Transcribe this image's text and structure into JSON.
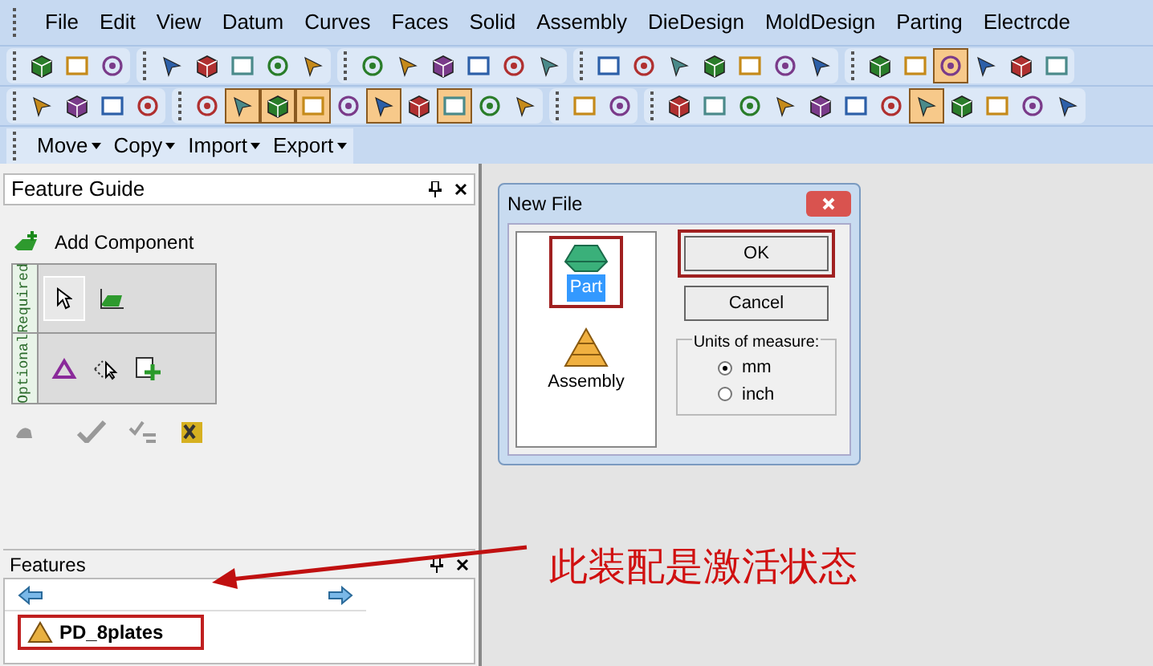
{
  "menu": [
    "File",
    "Edit",
    "View",
    "Datum",
    "Curves",
    "Faces",
    "Solid",
    "Assembly",
    "DieDesign",
    "MoldDesign",
    "Parting",
    "Electrcde"
  ],
  "toolbars": [
    [
      [
        {
          "pressed": false
        },
        {
          "pressed": false
        },
        {
          "pressed": false
        }
      ],
      [
        {
          "pressed": false
        },
        {
          "pressed": false
        },
        {
          "pressed": false
        },
        {
          "pressed": false
        },
        {
          "pressed": false
        }
      ],
      [
        {
          "pressed": false
        },
        {
          "pressed": false
        },
        {
          "pressed": false
        },
        {
          "pressed": false
        },
        {
          "pressed": false
        },
        {
          "pressed": false
        }
      ],
      [
        {
          "pressed": false
        },
        {
          "pressed": false
        },
        {
          "pressed": false
        },
        {
          "pressed": false
        },
        {
          "pressed": false
        },
        {
          "pressed": false
        },
        {
          "pressed": false
        }
      ],
      [
        {
          "pressed": false
        },
        {
          "pressed": false
        },
        {
          "pressed": true
        },
        {
          "pressed": false
        },
        {
          "pressed": false
        },
        {
          "pressed": false
        }
      ]
    ],
    [
      [
        {
          "pressed": false
        },
        {
          "pressed": false
        },
        {
          "pressed": false
        },
        {
          "pressed": false
        }
      ],
      [
        {
          "pressed": false
        },
        {
          "pressed": true
        },
        {
          "pressed": true
        },
        {
          "pressed": true
        },
        {
          "pressed": false
        },
        {
          "pressed": true
        },
        {
          "pressed": false
        },
        {
          "pressed": true
        },
        {
          "pressed": false
        },
        {
          "pressed": false
        }
      ],
      [
        {
          "pressed": false
        },
        {
          "pressed": false
        }
      ],
      [
        {
          "pressed": false
        },
        {
          "pressed": false
        },
        {
          "pressed": false
        },
        {
          "pressed": false
        },
        {
          "pressed": false
        },
        {
          "pressed": false
        },
        {
          "pressed": false
        },
        {
          "pressed": true
        },
        {
          "pressed": false
        },
        {
          "pressed": false
        },
        {
          "pressed": false
        },
        {
          "pressed": false
        }
      ]
    ]
  ],
  "menu_toolbar": [
    "Move",
    "Copy",
    "Import",
    "Export"
  ],
  "feature_guide": {
    "title": "Feature Guide",
    "command": "Add Component",
    "required_label": "Required",
    "optional_label": "Optional"
  },
  "features": {
    "title": "Features",
    "items": [
      {
        "label": "PD_8plates",
        "selected": true
      }
    ]
  },
  "dialog": {
    "title": "New File",
    "types": [
      {
        "label": "Part",
        "selected": true
      },
      {
        "label": "Assembly",
        "selected": false
      }
    ],
    "buttons": [
      "OK",
      "Cancel"
    ],
    "units_label": "Units of measure:",
    "units": [
      {
        "label": "mm",
        "selected": true
      },
      {
        "label": "inch",
        "selected": false
      }
    ]
  },
  "annotation": "此装配是激活状态"
}
